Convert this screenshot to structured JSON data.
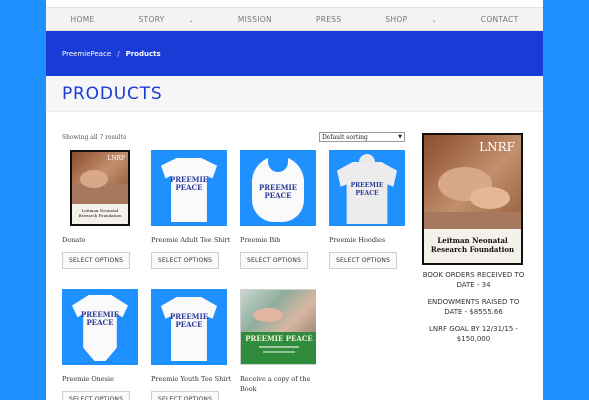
{
  "nav": {
    "items": [
      {
        "label": "HOME",
        "has_caret": false
      },
      {
        "label": "STORY",
        "has_caret": true
      },
      {
        "label": "MISSION",
        "has_caret": false
      },
      {
        "label": "PRESS",
        "has_caret": false
      },
      {
        "label": "SHOP",
        "has_caret": true
      },
      {
        "label": "CONTACT",
        "has_caret": false
      }
    ]
  },
  "breadcrumb": {
    "home": "PreemiePeace",
    "separator": "/",
    "current": "Products"
  },
  "page_title": "PRODUCTS",
  "results_count": "Showing all 7 results",
  "sort": {
    "selected": "Default sorting"
  },
  "products": [
    {
      "name": "Donate",
      "button": "SELECT OPTIONS"
    },
    {
      "name": "Preemie Adult Tee Shirt",
      "button": "SELECT OPTIONS"
    },
    {
      "name": "Preemie Bib",
      "button": "SELECT OPTIONS"
    },
    {
      "name": "Preemie Hoodies",
      "button": "SELECT OPTIONS"
    },
    {
      "name": "Preemie Onesie",
      "button": "SELECT OPTIONS"
    },
    {
      "name": "Preemie Youth Tee Shirt",
      "button": "SELECT OPTIONS"
    },
    {
      "name": "Receive a copy of the Book",
      "button": ""
    }
  ],
  "shirt_print": {
    "line1": "PREEMIE",
    "line2": "PEACE"
  },
  "lnrf": {
    "badge": "LNRF",
    "org_line1": "Leitman Neonatal",
    "org_line2": "Research Foundation"
  },
  "book_cover": {
    "title": "PREEMIE PEACE"
  },
  "sidebar": {
    "book_orders": "BOOK ORDERS RECEIVED TO DATE - 34",
    "endowments": "ENDOWMENTS RAISED TO DATE - $8555.66",
    "goal": "LNRF GOAL BY 12/31/15 - $150,000"
  },
  "colors": {
    "background": "#1e90ff",
    "band": "#1b3bd6",
    "title": "#1b3bd6"
  }
}
